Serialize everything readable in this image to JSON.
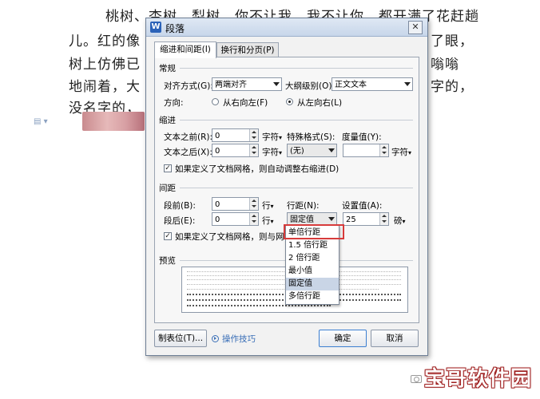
{
  "document": {
    "lines": [
      "桃树、杏树、梨树，你不让我，我不让你，都开满了花赶趟",
      "儿。红的像",
      "树上仿佛已",
      "地闹着，大",
      "没名字的，"
    ],
    "right_fragments": [
      "了眼，",
      "嗡嗡",
      "字的，"
    ]
  },
  "dialog": {
    "title": "段落",
    "title_icon": "W",
    "close_glyph": "✕",
    "tabs": [
      "缩进和间距(I)",
      "换行和分页(P)"
    ],
    "general": {
      "section": "常规",
      "align_label": "对齐方式(G):",
      "align_value": "两端对齐",
      "outline_label": "大纲级别(O):",
      "outline_value": "正文文本",
      "direction_label": "方向:",
      "rtl_label": "从右向左(F)",
      "ltr_label": "从左向右(L)",
      "direction_selected": "ltr"
    },
    "indent": {
      "section": "缩进",
      "before_label": "文本之前(R):",
      "before_value": "0",
      "before_unit": "字符",
      "after_label": "文本之后(X):",
      "after_value": "0",
      "after_unit": "字符",
      "special_label": "特殊格式(S):",
      "special_value": "(无)",
      "measure_label": "度量值(Y):",
      "measure_value": "",
      "measure_unit": "字符",
      "grid_check": "如果定义了文档网格，则自动调整右缩进(D)",
      "grid_checked": true
    },
    "spacing": {
      "section": "间距",
      "before_label": "段前(B):",
      "before_value": "0",
      "before_unit": "行",
      "after_label": "段后(E):",
      "after_value": "0",
      "after_unit": "行",
      "line_label": "行距(N):",
      "line_value": "固定值",
      "setting_label": "设置值(A):",
      "setting_value": "25",
      "setting_unit": "磅",
      "grid_check": "如果定义了文档网格，则与网格",
      "grid_checked": true
    },
    "preview": {
      "section": "预览"
    },
    "buttons": {
      "tabs": "制表位(T)...",
      "tips": "操作技巧",
      "ok": "确定",
      "cancel": "取消"
    },
    "line_spacing_options": [
      "单倍行距",
      "1.5 倍行距",
      "2 倍行距",
      "最小值",
      "固定值",
      "多倍行距"
    ],
    "line_spacing_selected": "固定值",
    "line_spacing_highlighted": "单倍行距"
  },
  "watermark": {
    "text": "宝哥软件园"
  },
  "colors": {
    "highlight": "#d73b3b",
    "accent": "#3a6fb7",
    "title_bg": "#c7d6ea"
  }
}
